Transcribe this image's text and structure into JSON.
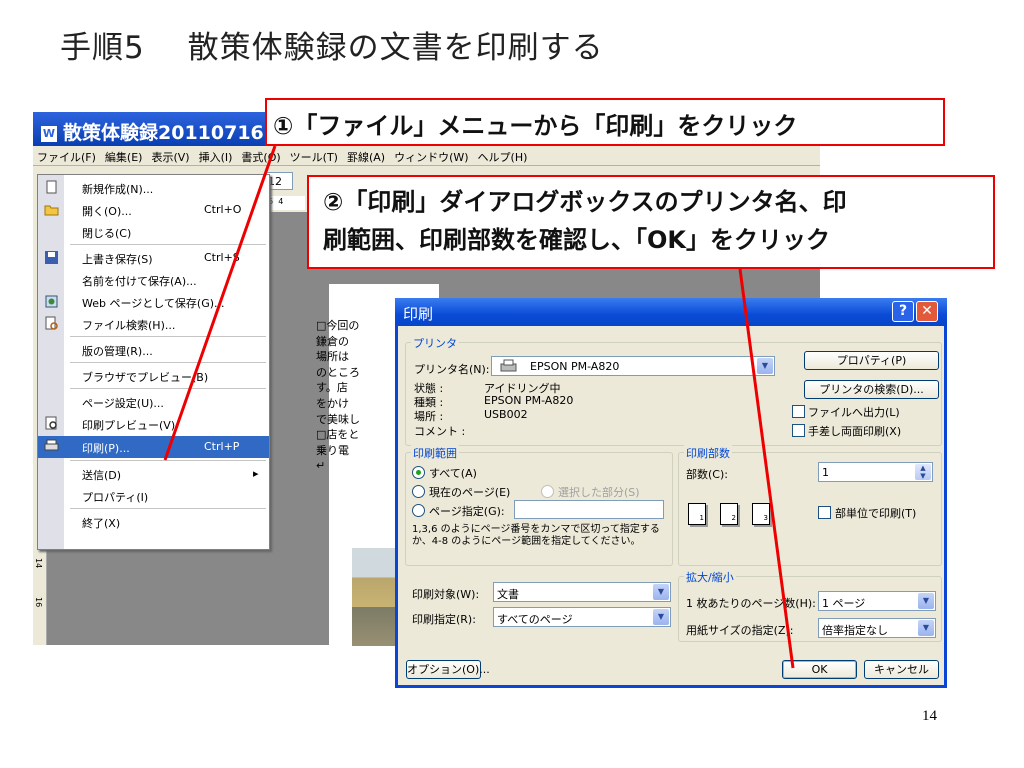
{
  "slide": {
    "title": "手順5　 散策体験録の文書を印刷する",
    "page_number": "14"
  },
  "word": {
    "title": "散策体験録20110716",
    "menubar": [
      "ファイル(F)",
      "編集(E)",
      "表示(V)",
      "挿入(I)",
      "書式(O)",
      "ツール(T)",
      "罫線(A)",
      "ウィンドウ(W)",
      "ヘルプ(H)"
    ],
    "toolbar_fontsize": "12",
    "ruler_marks": [
      "6",
      "4"
    ],
    "vruler_marks": [
      "14",
      "16"
    ],
    "document_lines": [
      "□今回の",
      "鎌倉の",
      "場所は",
      "のところ",
      "す。店",
      "をかけ",
      "で美味し",
      "□店をと",
      "乗り電",
      "↵"
    ]
  },
  "file_menu": {
    "items": [
      {
        "label": "新規作成(N)...",
        "shortcut": "",
        "icon": "new-doc-icon"
      },
      {
        "label": "開く(O)...",
        "shortcut": "Ctrl+O",
        "icon": "open-folder-icon"
      },
      {
        "label": "閉じる(C)",
        "shortcut": "",
        "icon": ""
      },
      {
        "label": "上書き保存(S)",
        "shortcut": "Ctrl+S",
        "icon": "save-icon"
      },
      {
        "label": "名前を付けて保存(A)...",
        "shortcut": "",
        "icon": ""
      },
      {
        "label": "Web ページとして保存(G)...",
        "shortcut": "",
        "icon": "web-page-icon"
      },
      {
        "label": "ファイル検索(H)...",
        "shortcut": "",
        "icon": "file-search-icon"
      },
      {
        "label": "版の管理(R)...",
        "shortcut": "",
        "icon": ""
      },
      {
        "label": "ブラウザでプレビュー(B)",
        "shortcut": "",
        "icon": ""
      },
      {
        "label": "ページ設定(U)...",
        "shortcut": "",
        "icon": ""
      },
      {
        "label": "印刷プレビュー(V)",
        "shortcut": "",
        "icon": "print-preview-icon"
      },
      {
        "label": "印刷(P)...",
        "shortcut": "Ctrl+P",
        "icon": "printer-icon"
      },
      {
        "label": "送信(D)",
        "shortcut": "▸",
        "icon": ""
      },
      {
        "label": "プロパティ(I)",
        "shortcut": "",
        "icon": ""
      },
      {
        "label": "終了(X)",
        "shortcut": "",
        "icon": ""
      }
    ]
  },
  "callouts": {
    "step1": "①「ファイル」メニューから「印刷」をクリック",
    "step2_line1": "②「印刷」ダイアログボックスのプリンタ名、印",
    "step2_line2": "刷範囲、印刷部数を確認し、「OK」をクリック"
  },
  "print_dialog": {
    "title": "印刷",
    "help": "?",
    "close": "✕",
    "printer": {
      "group": "プリンタ",
      "name_label": "プリンタ名(N):",
      "name_value": "EPSON PM-A820",
      "status_label": "状態 :",
      "status_value": "アイドリング中",
      "type_label": "種類 :",
      "type_value": "EPSON PM-A820",
      "location_label": "場所 :",
      "location_value": "USB002",
      "comment_label": "コメント :",
      "properties_button": "プロパティ(P)",
      "find_printer_button": "プリンタの検索(D)...",
      "print_to_file": "ファイルへ出力(L)",
      "manual_duplex": "手差し両面印刷(X)"
    },
    "range": {
      "group": "印刷範囲",
      "all": "すべて(A)",
      "current": "現在のページ(E)",
      "selection": "選択した部分(S)",
      "pages": "ページ指定(G):",
      "hint": "1,3,6 のようにページ番号をカンマで区切って指定するか、4-8 のようにページ範囲を指定してください。"
    },
    "copies": {
      "group": "印刷部数",
      "count_label": "部数(C):",
      "count_value": "1",
      "collate": "部単位で印刷(T)",
      "page_numbers": [
        "1",
        "1",
        "2",
        "2",
        "3",
        "3"
      ]
    },
    "print_what_label": "印刷対象(W):",
    "print_what_value": "文書",
    "print_label": "印刷指定(R):",
    "print_value": "すべてのページ",
    "zoom": {
      "group": "拡大/縮小",
      "pages_per_sheet_label": "1 枚あたりのページ数(H):",
      "pages_per_sheet_value": "1 ページ",
      "scale_label": "用紙サイズの指定(Z):",
      "scale_value": "倍率指定なし"
    },
    "options_button": "オプション(O)...",
    "ok_button": "OK",
    "cancel_button": "キャンセル"
  }
}
